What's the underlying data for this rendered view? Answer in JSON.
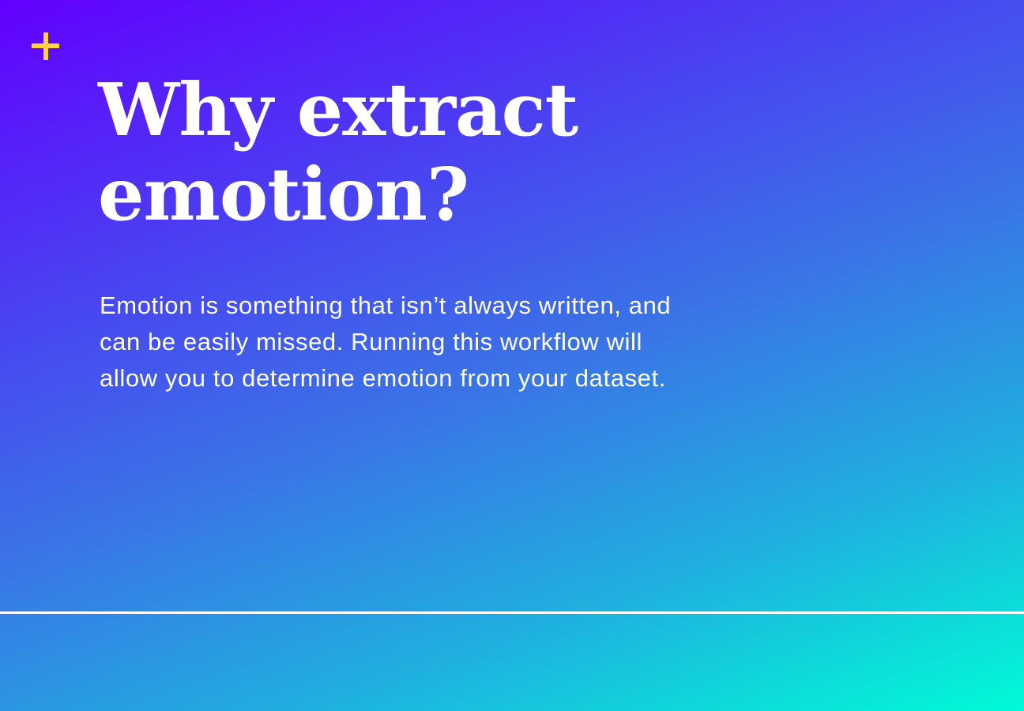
{
  "icons": {
    "corner": "plus-icon"
  },
  "colors": {
    "accent": "#ffd23f",
    "text": "#ffffff",
    "gradient_start": "#6200ff",
    "gradient_end": "#00fbd6"
  },
  "headline": {
    "line1": "Why extract",
    "line2": "emotion?"
  },
  "body": {
    "line1": "Emotion is something that isn’t always written, and",
    "line2": "can be easily missed. Running this workflow will",
    "line3": "allow you to determine emotion from your dataset."
  }
}
